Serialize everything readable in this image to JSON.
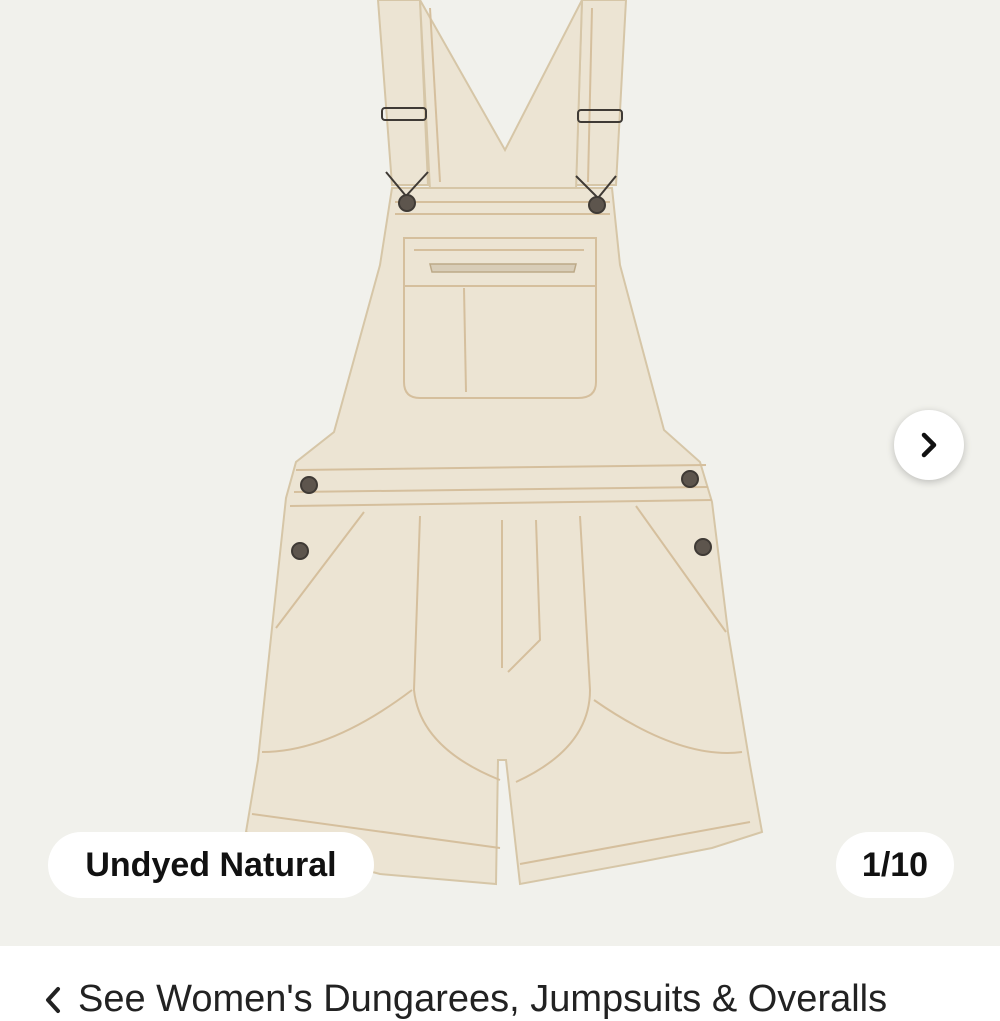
{
  "gallery": {
    "image_alt": "Undyed Natural overalls",
    "color_label": "Undyed Natural",
    "counter": "1/10",
    "next_icon": "chevron-right-icon"
  },
  "breadcrumb": {
    "back_icon": "chevron-left-icon",
    "items": [
      "See Women's Dungarees, Jumpsuits & Overalls"
    ]
  },
  "colors": {
    "gallery_bg": "#f1f1ec",
    "fabric": "#ece4d3",
    "stitching": "#d9c4a2",
    "pill_bg": "#ffffff",
    "text": "#111111"
  }
}
